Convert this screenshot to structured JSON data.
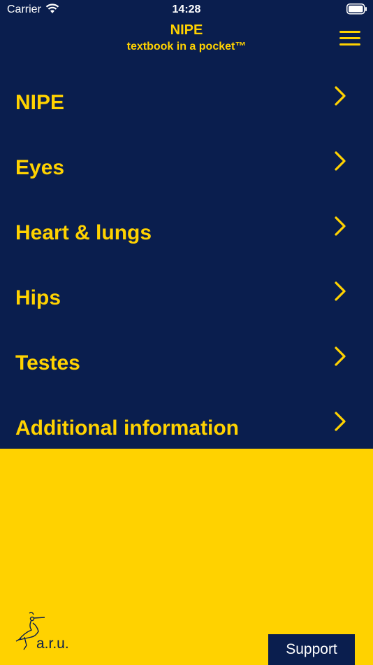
{
  "status_bar": {
    "carrier": "Carrier",
    "time": "14:28"
  },
  "header": {
    "title": "NIPE",
    "subtitle": "textbook in a pocket™",
    "menu_icon": "hamburger-menu-icon"
  },
  "menu_items": [
    {
      "label": "NIPE"
    },
    {
      "label": "Eyes"
    },
    {
      "label": "Heart & lungs"
    },
    {
      "label": "Hips"
    },
    {
      "label": "Testes"
    },
    {
      "label": "Additional information"
    }
  ],
  "footer": {
    "logo_text": "a.r.u.",
    "support_label": "Support"
  },
  "colors": {
    "navy": "#0A1E4E",
    "yellow": "#FFD200"
  }
}
